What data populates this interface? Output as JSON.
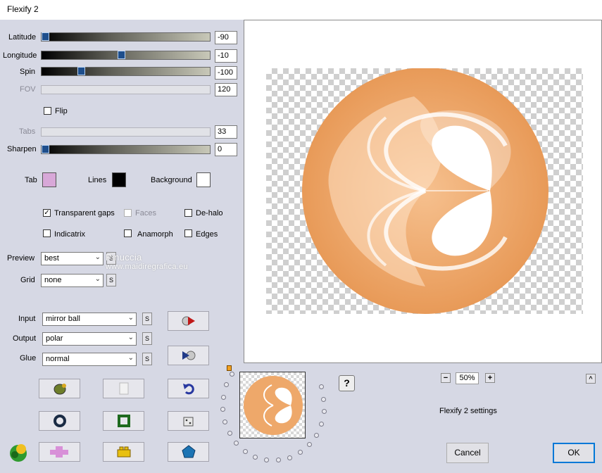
{
  "window": {
    "title": "Flexify 2"
  },
  "sliders": [
    {
      "label": "Latitude",
      "value": "-90",
      "enabled": true,
      "pos": 0.0
    },
    {
      "label": "Longitude",
      "value": "-10",
      "enabled": true,
      "pos": 0.47
    },
    {
      "label": "Spin",
      "value": "-100",
      "enabled": true,
      "pos": 0.22
    },
    {
      "label": "FOV",
      "value": "120",
      "enabled": false
    },
    {
      "label": "Tabs",
      "value": "33",
      "enabled": false
    },
    {
      "label": "Sharpen",
      "value": "0",
      "enabled": true,
      "pos": 0.0
    }
  ],
  "flip": {
    "label": "Flip",
    "checked": false
  },
  "colors": {
    "tab": {
      "label": "Tab",
      "color": "#d8a8d8"
    },
    "lines": {
      "label": "Lines",
      "color": "#000000"
    },
    "background": {
      "label": "Background",
      "color": "#ffffff"
    }
  },
  "options": {
    "transparent_gaps": {
      "label": "Transparent gaps",
      "checked": true
    },
    "faces": {
      "label": "Faces",
      "checked": false,
      "enabled": false
    },
    "de_halo": {
      "label": "De-halo",
      "checked": false
    },
    "indicatrix": {
      "label": "Indicatrix",
      "checked": false
    },
    "anamorph": {
      "label": "Anamorph",
      "checked": false
    },
    "edges": {
      "label": "Edges",
      "checked": false
    }
  },
  "preview_select": {
    "label": "Preview",
    "value": "best"
  },
  "grid_select": {
    "label": "Grid",
    "value": "none"
  },
  "input_select": {
    "label": "Input",
    "value": "mirror ball"
  },
  "output_select": {
    "label": "Output",
    "value": "polar"
  },
  "glue_select": {
    "label": "Glue",
    "value": "normal"
  },
  "s_label": "S",
  "watermark": "Pinuccia\n www.maidiregrafica.eu",
  "zoom": {
    "value": "50%",
    "minus": "−",
    "plus": "+"
  },
  "settings_label": "Flexify 2 settings",
  "help_label": "?",
  "collapse_label": "^",
  "buttons": {
    "cancel": "Cancel",
    "ok": "OK"
  },
  "accent_color": "#0078d7",
  "image_color": "#f0a868"
}
